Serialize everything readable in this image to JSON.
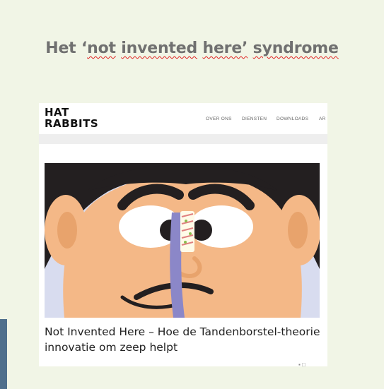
{
  "slide": {
    "title_prefix": "Het ‘",
    "title_words": [
      "not",
      "invented",
      "here’",
      "syndrome"
    ]
  },
  "site": {
    "logo_line1": "HAT",
    "logo_line2": "RABBITS",
    "nav": [
      "OVER ONS",
      "DIENSTEN",
      "DOWNLOADS",
      "AR"
    ]
  },
  "article": {
    "title": "Not Invented Here – Hoe de Tandenborstel-theorie innovatie om zeep helpt"
  },
  "colors": {
    "slide_bg": "#f1f5e6",
    "title_gray": "#707070",
    "spellcheck_red": "#e02020",
    "hero_bg": "#d8dcef",
    "skin": "#f4b887",
    "hair": "#231f20",
    "toothbrush": "#8b87c8"
  }
}
